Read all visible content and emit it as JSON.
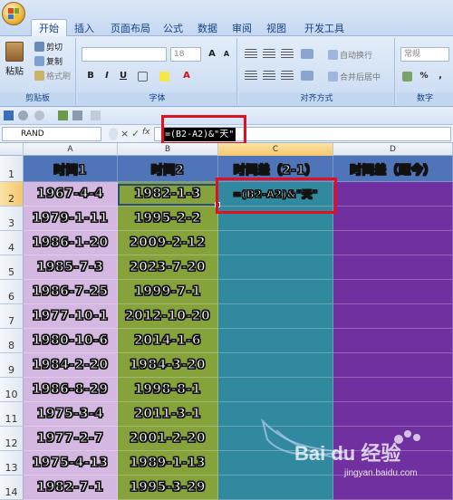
{
  "ribbon": {
    "tabs": [
      "开始",
      "插入",
      "页面布局",
      "公式",
      "数据",
      "审阅",
      "视图",
      "开发工具"
    ],
    "clipboard": {
      "paste": "粘贴",
      "cut": "剪切",
      "copy": "复制",
      "format_painter": "格式刷",
      "label": "剪贴板"
    },
    "font": {
      "name": "",
      "size": "18",
      "label": "字体",
      "bold": "B",
      "italic": "I",
      "underline": "U",
      "grow": "A",
      "shrink": "A",
      "font_color": "A"
    },
    "alignment": {
      "wrap": "自动换行",
      "merge": "合并后居中",
      "label": "对齐方式"
    },
    "number": {
      "format": "常规",
      "percent": "%",
      "comma": ",",
      "label": "数字"
    }
  },
  "formula_bar": {
    "name_box": "RAND",
    "cancel": "×",
    "enter": "✓",
    "fx": "fx",
    "formula": "=(B2-A2)&\"天\""
  },
  "columns": [
    "A",
    "B",
    "C",
    "D"
  ],
  "rows": [
    "1",
    "2",
    "3",
    "4",
    "5",
    "6",
    "7",
    "8",
    "9",
    "10",
    "11",
    "12",
    "13",
    "14"
  ],
  "sheet": {
    "headers": [
      "时间1",
      "时间2",
      "时间差（2-1）",
      "时间差（距今）"
    ],
    "col_a": [
      "1967-4-4",
      "1979-1-11",
      "1986-1-20",
      "1985-7-3",
      "1986-7-25",
      "1977-10-1",
      "1980-10-6",
      "1984-2-20",
      "1986-8-29",
      "1975-3-4",
      "1977-2-7",
      "1975-4-13",
      "1982-7-1"
    ],
    "col_b": [
      "1982-1-3",
      "1995-2-2",
      "2009-2-12",
      "2023-7-20",
      "1999-7-1",
      "2012-10-20",
      "2014-1-6",
      "1984-3-20",
      "1998-8-1",
      "2011-3-1",
      "2001-2-20",
      "1989-1-13",
      "1995-3-29"
    ],
    "c2_formula": "=(B2-A2)&\"天\""
  },
  "watermark": {
    "main": "Bai du 经验",
    "sub": "jingyan.baidu.com"
  },
  "colors": {
    "col_a": "#d4b8e2",
    "col_b": "#86a23a",
    "col_c": "#30899e",
    "col_d": "#7030a0",
    "header_row": "#4f74b8",
    "highlight": "#e01020"
  }
}
